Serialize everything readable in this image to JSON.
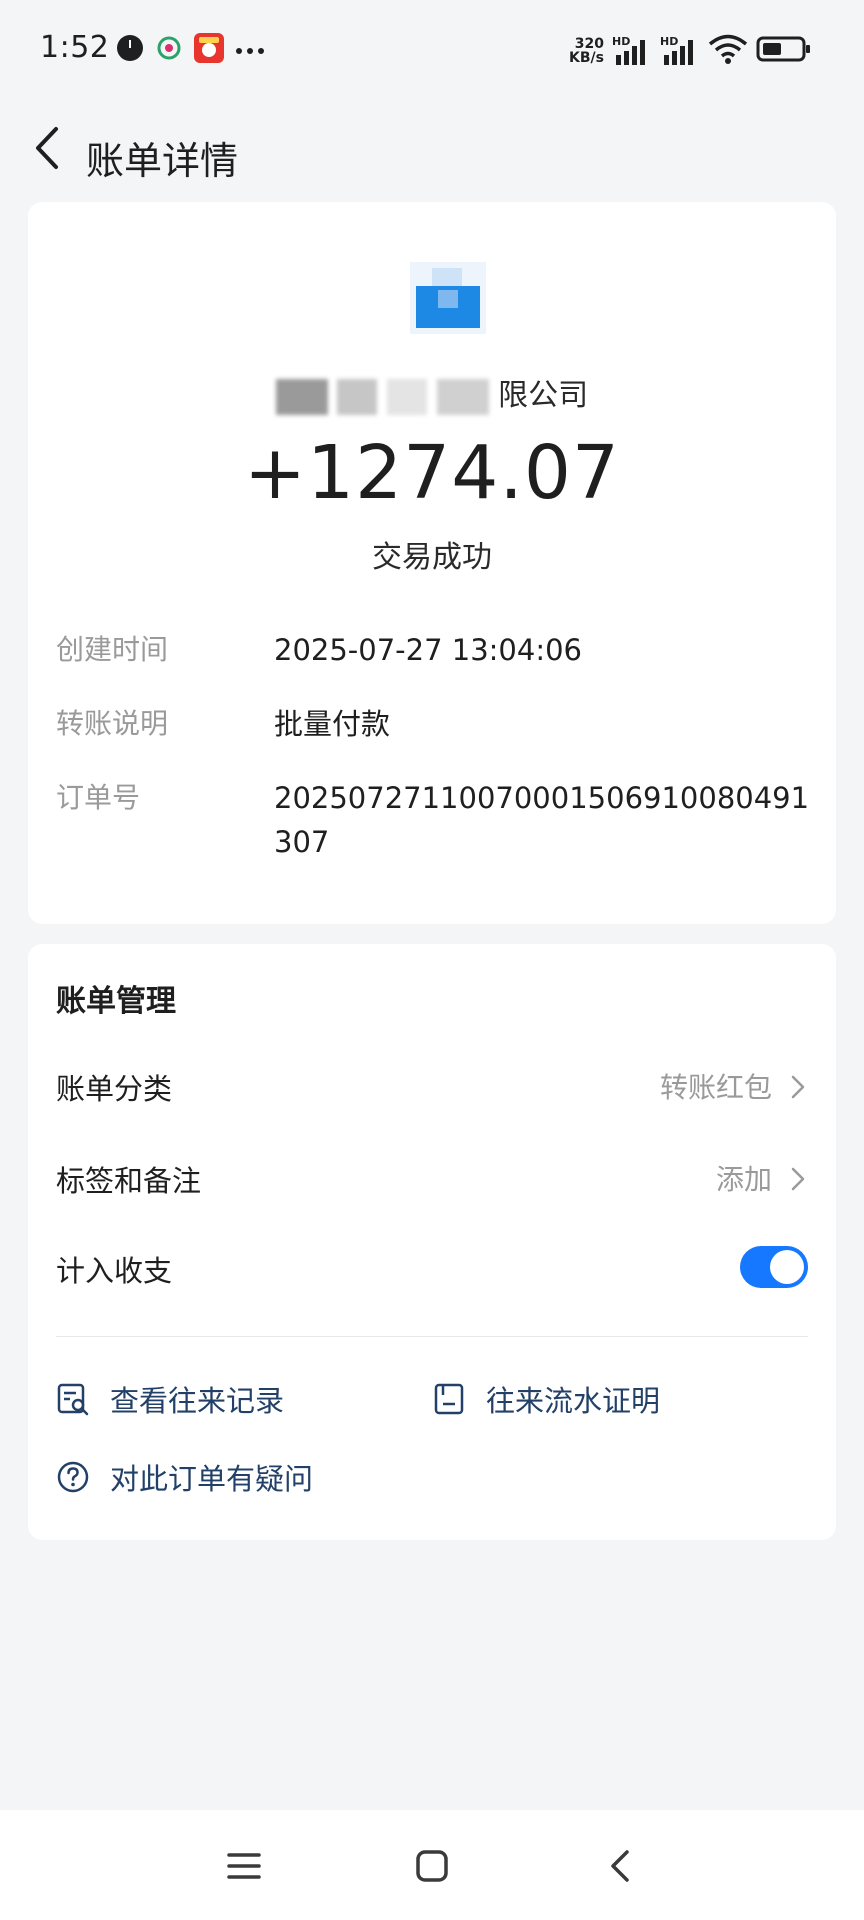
{
  "status_bar": {
    "time": "1:52",
    "net_speed_value": "320",
    "net_speed_unit": "KB/s",
    "hd_1": "HD",
    "hd_2": "HD"
  },
  "header": {
    "title": "账单详情"
  },
  "transaction": {
    "merchant_name_visible": "限公司",
    "amount": "+1274.07",
    "status": "交易成功"
  },
  "details": [
    {
      "label": "创建时间",
      "value": "2025-07-27 13:04:06"
    },
    {
      "label": "转账说明",
      "value": "批量付款"
    },
    {
      "label": "订单号",
      "value": "20250727110070001506910080491307"
    }
  ],
  "management": {
    "title": "账单管理",
    "category_label": "账单分类",
    "category_value": "转账红包",
    "tags_label": "标签和备注",
    "tags_value": "添加",
    "include_label": "计入收支",
    "include_enabled": true
  },
  "links": {
    "records": "查看往来记录",
    "statement": "往来流水证明",
    "question": "对此订单有疑问"
  },
  "colors": {
    "accent": "#1677ff",
    "link_text": "#234068",
    "muted": "#9a9a9a",
    "background": "#f4f5f7"
  }
}
